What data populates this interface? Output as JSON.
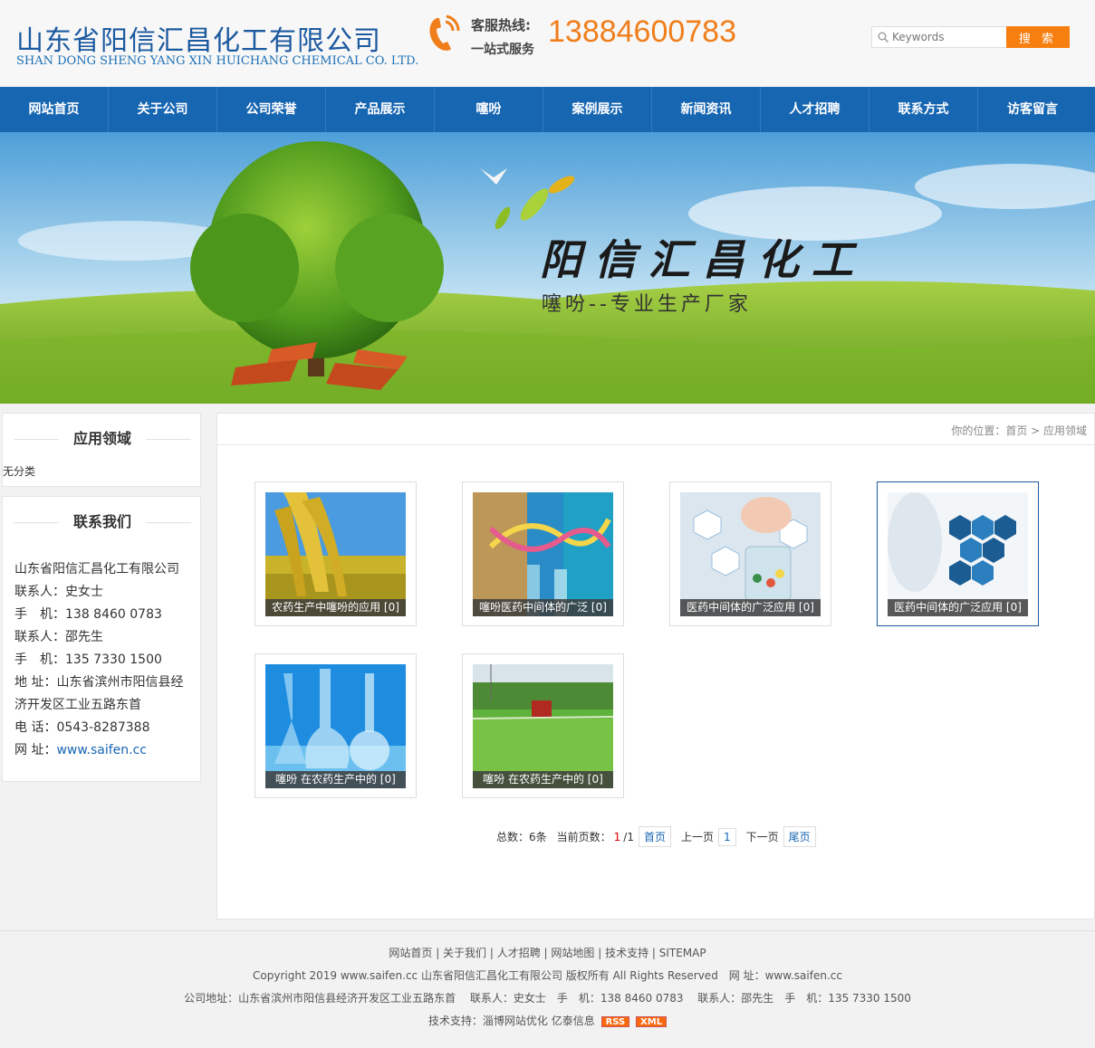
{
  "header": {
    "company_cn": "山东省阳信汇昌化工有限公司",
    "company_en": "SHAN DONG SHENG YANG XIN HUICHANG CHEMICAL CO. LTD.",
    "hotline_label": "客服热线:",
    "hotline_sub": "一站式服务",
    "hotline_number": "13884600783",
    "search_placeholder": "Keywords",
    "search_button": "搜 索"
  },
  "nav": [
    "网站首页",
    "关于公司",
    "公司荣誉",
    "产品展示",
    "噻吩",
    "案例展示",
    "新闻资讯",
    "人才招聘",
    "联系方式",
    "访客留言"
  ],
  "banner": {
    "title": "阳信汇昌化工",
    "subtitle": "噻吩--专业生产厂家"
  },
  "sidebar": {
    "category_title": "应用领域",
    "category_item": "无分类",
    "contact_title": "联系我们",
    "contact_lines": [
      "山东省阳信汇昌化工有限公司",
      "联系人：史女士",
      "手　机：138 8460 0783",
      "联系人：邵先生",
      "手　机：135 7330 1500",
      "地 址：山东省滨州市阳信县经",
      "济开发区工业五路东首",
      "电 话：0543-8287388"
    ],
    "website_label": "网 址：",
    "website_url": "www.saifen.cc"
  },
  "breadcrumb": "你的位置：首页 > 应用领域",
  "cards": [
    {
      "caption": "农药生产中噻吩的应用 [0]",
      "image": "rice-field"
    },
    {
      "caption": "噻吩医药中间体的广泛 [0]",
      "image": "dna-lab"
    },
    {
      "caption": "医药中间体的广泛应用 [0]",
      "image": "medicine-jar"
    },
    {
      "caption": "医药中间体的广泛应用 [0]",
      "image": "medical-icons"
    },
    {
      "caption": "噻吩 在农药生产中的 [0]",
      "image": "lab-glassware"
    },
    {
      "caption": "噻吩 在农药生产中的 [0]",
      "image": "tractor-field"
    }
  ],
  "pager": {
    "total_label": "总数：6条",
    "current_label": "当前页数：",
    "current": "1",
    "total_pages": "/1",
    "first": "首页",
    "prev": "上一页",
    "page": "1",
    "next": "下一页",
    "last": "尾页"
  },
  "footer": {
    "links": "网站首页 | 关于我们 | 人才招聘 | 网站地图 | 技术支持 | SITEMAP",
    "copyright": "Copyright 2019 www.saifen.cc 山东省阳信汇昌化工有限公司 版权所有 All Rights Reserved　网 址：www.saifen.cc",
    "address": "公司地址：山东省滨州市阳信县经济开发区工业五路东首　 联系人：史女士　手　机：138 8460 0783　 联系人：邵先生　手　机：135 7330 1500",
    "tech": "技术支持：淄博网站优化  亿泰信息",
    "rss": "RSS",
    "xml": "XML"
  },
  "colors": {
    "brand_blue": "#1766b2",
    "accent_orange": "#f07e1a"
  }
}
